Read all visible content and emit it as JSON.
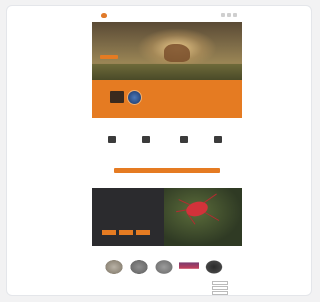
{
  "nav": {
    "brand": "",
    "menu": [
      "",
      "",
      "",
      ""
    ]
  },
  "hero": {
    "title": "",
    "subtitle": "",
    "button": ""
  },
  "promo": {
    "title": "",
    "text": ""
  },
  "why": {
    "title": "",
    "features": [
      {
        "title": "",
        "desc": ""
      },
      {
        "title": "",
        "desc": ""
      },
      {
        "title": "",
        "desc": ""
      },
      {
        "title": "",
        "desc": ""
      }
    ],
    "cta": ""
  },
  "dark": {
    "title": "",
    "text": "",
    "buttons": [
      "",
      "",
      ""
    ]
  },
  "products": {
    "title": "",
    "items": [
      "",
      "",
      "",
      "",
      ""
    ],
    "list": "",
    "buttons": [
      "",
      "",
      ""
    ]
  },
  "colors": {
    "accent": "#e57b22",
    "dark_section": "#2b2b2e",
    "tick": "#d3323a"
  }
}
